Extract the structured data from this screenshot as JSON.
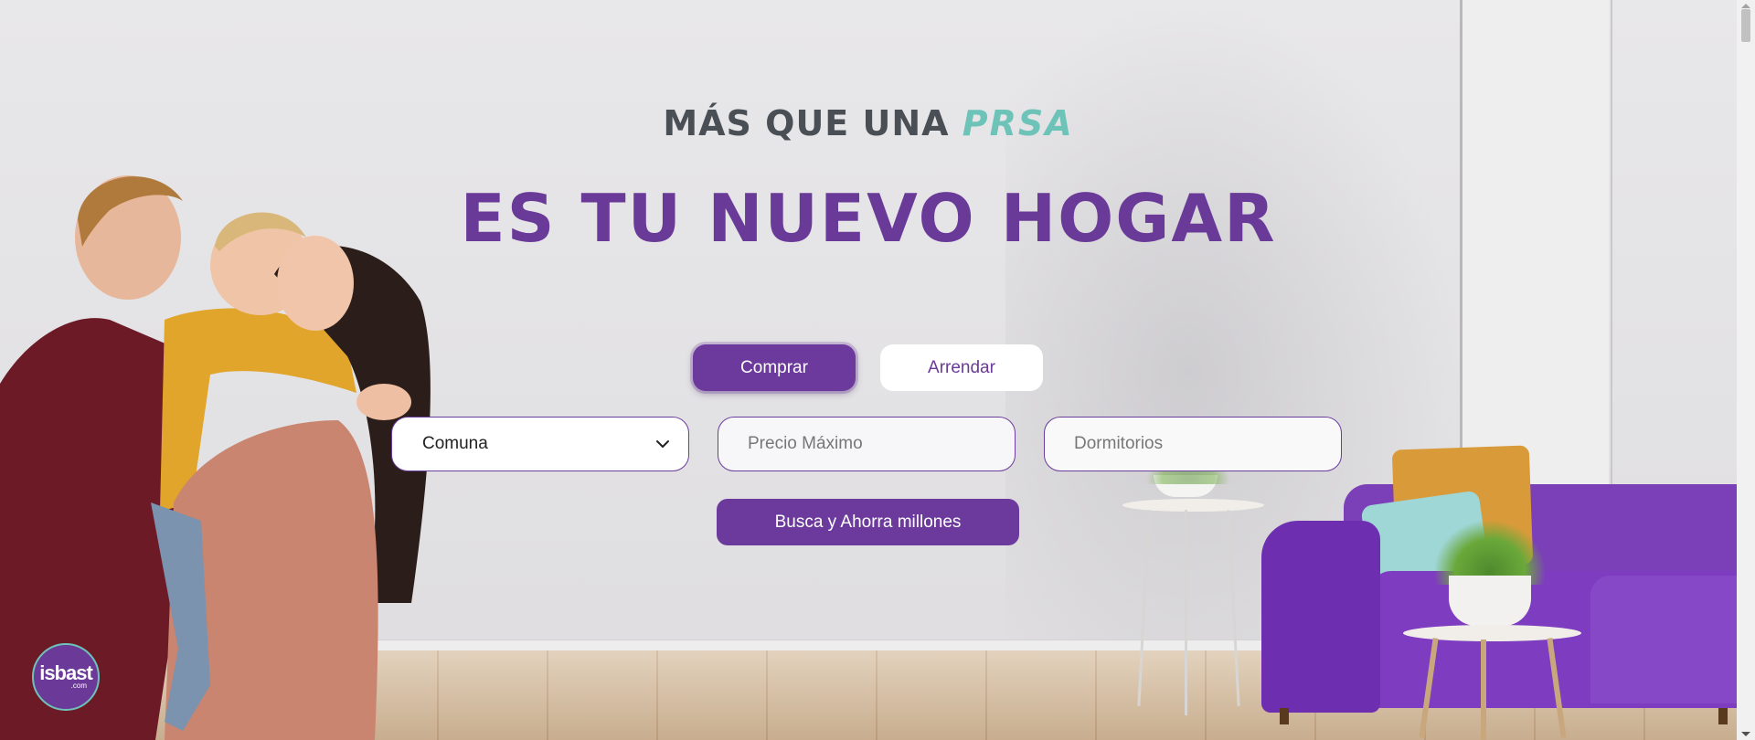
{
  "hero": {
    "eyebrow_text": "MÁS QUE UNA ",
    "eyebrow_accent": "PRSA",
    "headline": "ES TU NUEVO HOGAR"
  },
  "tabs": [
    {
      "label": "Comprar",
      "active": true
    },
    {
      "label": "Arrendar",
      "active": false
    }
  ],
  "search": {
    "comuna_selected": "Comuna",
    "precio_placeholder": "Precio Máximo",
    "dormitorios_placeholder": "Dormitorios",
    "button_label": "Busca y Ahorra millones"
  },
  "logo": {
    "main": "isbast",
    "sub": ".com"
  },
  "colors": {
    "brand_purple": "#6c3a9c",
    "accent_teal": "#6ec3b8",
    "heading_gray": "#4a4e55"
  },
  "icons": {
    "select_arrow": "chevron-down-icon"
  }
}
